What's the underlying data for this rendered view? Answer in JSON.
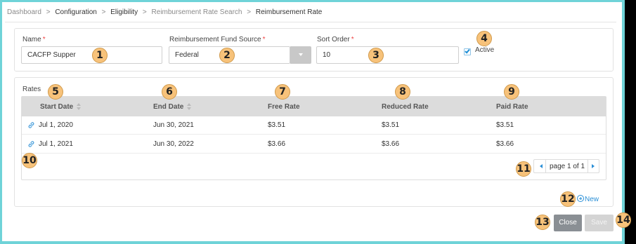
{
  "breadcrumb": {
    "items": [
      "Dashboard",
      "Configuration",
      "Eligibility",
      "Reimbursement Rate Search",
      "Reimbursement Rate"
    ],
    "separator": ">"
  },
  "form": {
    "name_label": "Name",
    "name_value": "CACFP Supper",
    "fund_source_label": "Reimbursement Fund Source",
    "fund_source_value": "Federal",
    "sort_order_label": "Sort Order",
    "sort_order_value": "10",
    "required_mark": "*",
    "active_label": "Active",
    "active_checked": true
  },
  "rates": {
    "title": "Rates",
    "columns": [
      "Start Date",
      "End Date",
      "Free Rate",
      "Reduced Rate",
      "Paid Rate"
    ],
    "rows": [
      {
        "start": "Jul 1, 2020",
        "end": "Jun 30, 2021",
        "free": "$3.51",
        "reduced": "$3.51",
        "paid": "$3.51"
      },
      {
        "start": "Jul 1, 2021",
        "end": "Jun 30, 2022",
        "free": "$3.66",
        "reduced": "$3.66",
        "paid": "$3.66"
      }
    ],
    "pager_text": "page 1 of 1"
  },
  "actions": {
    "new_label": "New",
    "close_label": "Close",
    "save_label": "Save"
  },
  "annotations": [
    "1",
    "2",
    "3",
    "4",
    "5",
    "6",
    "7",
    "8",
    "9",
    "10",
    "11",
    "12",
    "13",
    "14"
  ],
  "icons": {
    "row_link": "link-icon",
    "sort": "sort-icon",
    "new": "plus-circle-icon",
    "dropdown": "chevron-down-icon"
  },
  "colors": {
    "accent": "#2a8fd6",
    "badge": "#f7c27a",
    "header_bg": "#dcdcdc",
    "close_button": "#8a8f94",
    "save_button_disabled": "#d4d4d4",
    "frame": "#6fd3d8"
  }
}
